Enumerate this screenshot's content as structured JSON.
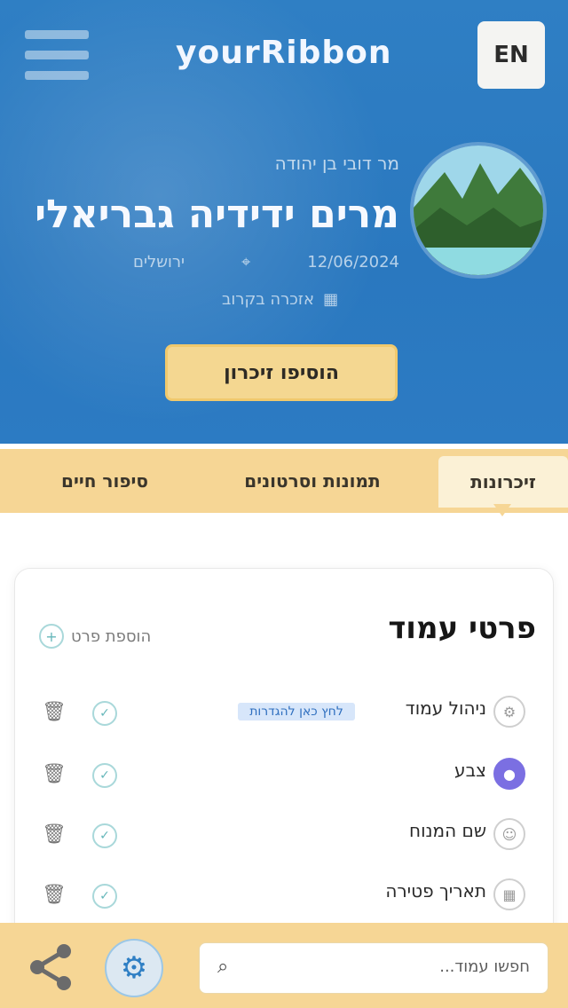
{
  "header": {
    "logo_text": "yourRibbon",
    "lang_label": "EN",
    "menu_icon": "hamburger-icon"
  },
  "profile": {
    "subtitle": "מר דובי בן יהודה",
    "name": "מרים ידידיה גבריאלי",
    "meta_date": "12/06/2024",
    "meta_location": "ירושלים",
    "meta_extra": "אזכרה בקרוב",
    "cta_label": "הוסיפו זיכרון"
  },
  "tabs": [
    {
      "label": "סיפור חיים"
    },
    {
      "label": "תמונות וסרטונים"
    },
    {
      "label": "זיכרונות"
    }
  ],
  "card": {
    "title": "פרטי עמוד",
    "action_label": "הוספת פרט",
    "rows": [
      {
        "label": "ניהול עמוד",
        "badge": "לחץ כאן להגדרות",
        "icon": "settings-icon"
      },
      {
        "label": "צבע",
        "badge": "",
        "icon": "palette-icon"
      },
      {
        "label": "שם המנוח",
        "badge": "",
        "icon": "user-icon"
      },
      {
        "label": "תאריך פטירה",
        "badge": "",
        "icon": "calendar-icon"
      }
    ]
  },
  "bottombar": {
    "search_placeholder": "חפשו עמוד...",
    "share_icon": "share-icon",
    "gear_icon": "gear-icon",
    "search_icon": "search-icon"
  },
  "colors": {
    "hero_blue": "#2f7fc4",
    "accent_yellow": "#f6d695",
    "cta_yellow": "#f4d791",
    "purple": "#7b6fe2"
  }
}
